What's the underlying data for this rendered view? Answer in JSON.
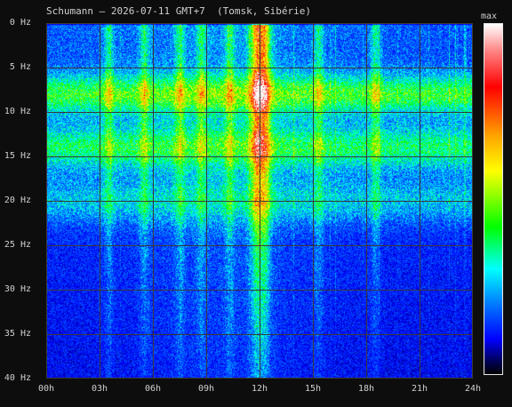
{
  "chart_data": {
    "type": "heatmap",
    "title": "Schumann – 2026-07-11 GMT+7  (Tomsk, Sibérie)",
    "xlabel": "",
    "ylabel": "",
    "x_ticks": [
      "00h",
      "03h",
      "06h",
      "09h",
      "12h",
      "15h",
      "18h",
      "21h",
      "24h"
    ],
    "y_ticks": [
      "0 Hz",
      "5 Hz",
      "10 Hz",
      "15 Hz",
      "20 Hz",
      "25 Hz",
      "30 Hz",
      "35 Hz",
      "40 Hz"
    ],
    "xlim": [
      0,
      24
    ],
    "ylim": [
      0,
      40
    ],
    "x_unit": "h",
    "y_unit": "Hz",
    "colorbar_label": "max",
    "colorscale": [
      "#000000",
      "#000060",
      "#0000ff",
      "#0060ff",
      "#00ffff",
      "#00ff00",
      "#ffff00",
      "#ffa500",
      "#ff0000",
      "#ff8080",
      "#ffffff"
    ],
    "grid": true,
    "resonance_bands_hz": [
      8,
      14,
      20
    ],
    "broadband_bursts_h": [
      3.5,
      5.5,
      7.5,
      8.7,
      10.3,
      11.8,
      12.3,
      15.3,
      18.5
    ]
  }
}
